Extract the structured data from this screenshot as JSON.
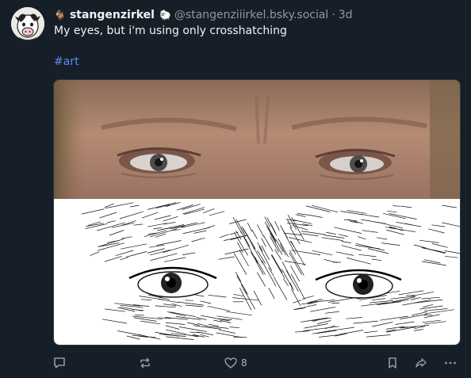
{
  "post": {
    "author": {
      "display_name": "stangenzirkel",
      "handle": "@stangenziiirkel.bsky.social",
      "name_emoji": "🐐",
      "handle_emoji": "🐑",
      "avatar_icon": "cow-avatar-icon"
    },
    "separator": "·",
    "timestamp": "3d",
    "text": "My eyes, but i'm using only crosshatching",
    "hashtag": "#art",
    "media": {
      "top_image": "photo of eyes",
      "bottom_image": "crosshatch drawing of eyes"
    },
    "actions": {
      "reply_icon": "reply-icon",
      "repost_icon": "repost-icon",
      "like_icon": "heart-icon",
      "like_count": "8",
      "bookmark_icon": "bookmark-icon",
      "share_icon": "share-icon",
      "more_icon": "more-icon"
    }
  },
  "colors": {
    "background": "#161e27",
    "text": "#f1f3f5",
    "muted": "#8d98a5",
    "link": "#5b8cf0"
  }
}
